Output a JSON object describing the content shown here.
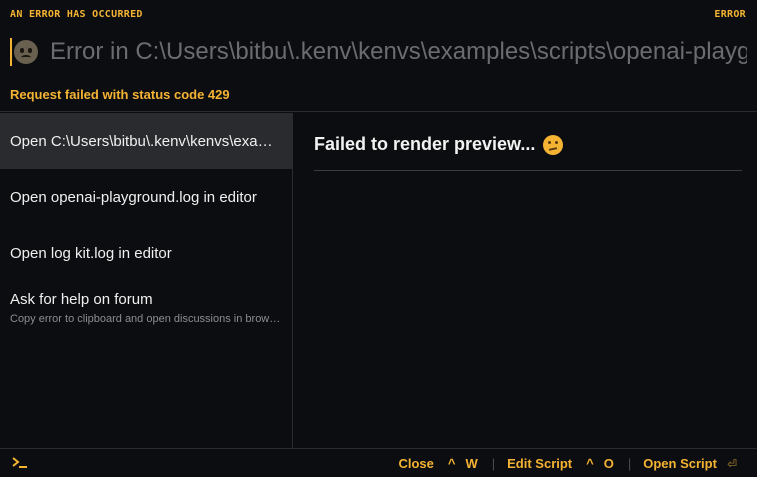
{
  "header": {
    "left_label": "AN ERROR HAS OCCURRED",
    "right_label": "ERROR",
    "input_value": "Error in C:\\Users\\bitbu\\.kenv\\kenvs\\examples\\scripts\\openai-playground.js",
    "status": "Request failed with status code 429"
  },
  "choices": [
    {
      "name": "Open C:\\Users\\bitbu\\.kenv\\kenvs\\examples\\scripts\\openai-playground.js in editor",
      "description": ""
    },
    {
      "name": "Open openai-playground.log in editor",
      "description": ""
    },
    {
      "name": "Open log kit.log in editor",
      "description": ""
    },
    {
      "name": "Ask for help on forum",
      "description": "Copy error to clipboard and open discussions in browser"
    }
  ],
  "preview": {
    "title": "Failed to render preview..."
  },
  "footer": {
    "actions": [
      {
        "label": "Close",
        "keys": [
          "^",
          "W"
        ]
      },
      {
        "label": "Edit Script",
        "keys": [
          "^",
          "O"
        ]
      },
      {
        "label": "Open Script",
        "keys": [
          "⏎"
        ]
      }
    ]
  },
  "icons": {
    "input_prefix": "sad-face-icon",
    "preview_suffix": "thinking-face-icon",
    "footer_logo": "terminal-prompt-icon"
  },
  "colors": {
    "accent": "#f5b334",
    "background": "#0c0d10",
    "active_row": "#2a2b2e"
  }
}
